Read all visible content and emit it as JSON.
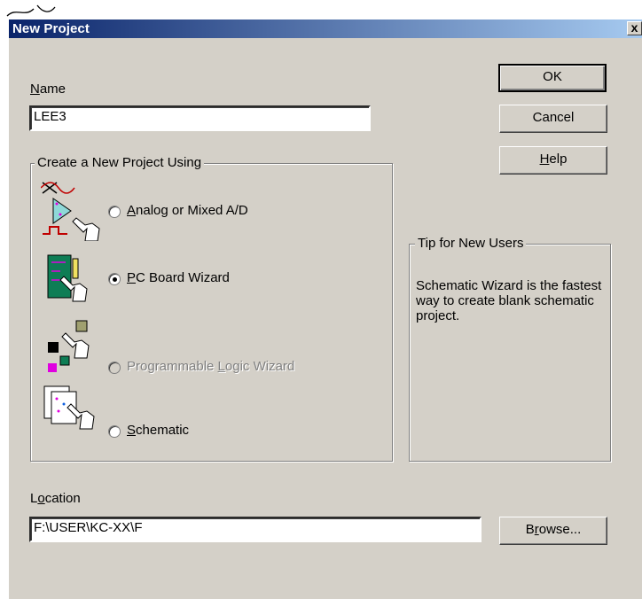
{
  "dialog": {
    "title": "New Project",
    "close_glyph": "x"
  },
  "name_field": {
    "label_mnemonic": "N",
    "label_rest": "ame",
    "value": "LEE3"
  },
  "buttons": {
    "ok": "OK",
    "cancel": "Cancel",
    "help_mnemonic": "H",
    "help_rest": "elp",
    "browse_pre": "B",
    "browse_mnemonic": "r",
    "browse_rest": "owse..."
  },
  "project_group": {
    "title": "Create a New Project Using",
    "options": [
      {
        "pre": "",
        "mnemonic": "A",
        "rest": "nalog or Mixed A/D",
        "selected": false,
        "enabled": true,
        "icon": "analog-mixed-icon"
      },
      {
        "pre": "",
        "mnemonic": "P",
        "rest": "C Board Wizard",
        "selected": true,
        "enabled": true,
        "icon": "pc-board-icon"
      },
      {
        "pre": "Programmable ",
        "mnemonic": "L",
        "rest": "ogic Wizard",
        "selected": false,
        "enabled": false,
        "icon": "programmable-logic-icon"
      },
      {
        "pre": "",
        "mnemonic": "S",
        "rest": "chematic",
        "selected": false,
        "enabled": true,
        "icon": "schematic-icon"
      }
    ]
  },
  "tip_group": {
    "title": "Tip for New Users",
    "text": "Schematic Wizard is the fastest way to create blank schematic project."
  },
  "location_field": {
    "label_pre": "L",
    "label_mnemonic": "o",
    "label_rest": "cation",
    "value": "F:\\USER\\KC-XX\\F"
  },
  "colors": {
    "title_gradient_start": "#0a246a",
    "title_gradient_end": "#a6caf0",
    "dialog_face": "#d4d0c8"
  }
}
